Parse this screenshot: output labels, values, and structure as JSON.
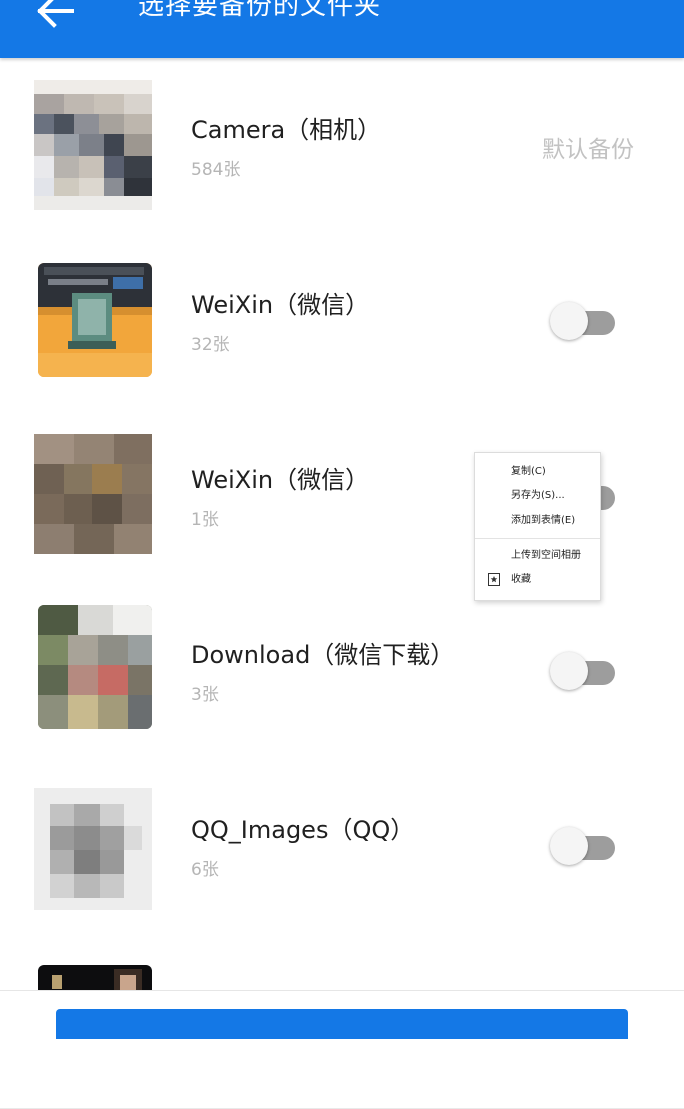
{
  "header": {
    "title": "选择要备份的文件夹",
    "back_icon": "arrow-left-icon"
  },
  "folders": [
    {
      "name": "Camera（相机）",
      "count": "584张",
      "status": "默认备份"
    },
    {
      "name": "WeiXin（微信）",
      "count": "32张",
      "toggle_on": false
    },
    {
      "name": "WeiXin（微信）",
      "count": "1张",
      "toggle_on": false
    },
    {
      "name": "Download（微信下载）",
      "count": "3张",
      "toggle_on": false
    },
    {
      "name": "QQ_Images（QQ）",
      "count": "6张",
      "toggle_on": false
    }
  ],
  "context_menu": {
    "items": [
      "复制(C)",
      "另存为(S)...",
      "添加到表情(E)",
      "上传到空间相册",
      "收藏"
    ]
  },
  "colors": {
    "primary": "#1478e6",
    "toggle_track": "#9d9d9d",
    "muted_text": "#b5b5b5"
  }
}
